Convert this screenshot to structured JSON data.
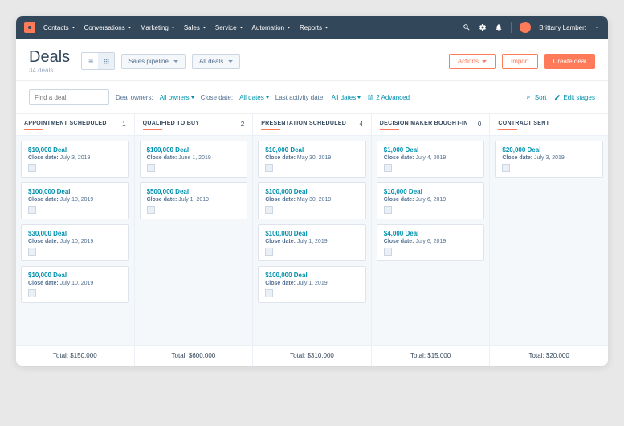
{
  "nav": {
    "items": [
      "Contacts",
      "Conversations",
      "Marketing",
      "Sales",
      "Service",
      "Automation",
      "Reports"
    ],
    "user": "Brittany Lambert"
  },
  "header": {
    "title": "Deals",
    "subtitle": "34 deals",
    "pipeline": "Sales pipeline",
    "filter": "All deals",
    "actions": "Actions",
    "import": "Import",
    "create": "Create deal"
  },
  "filters": {
    "search_placeholder": "Find a deal",
    "owners_label": "Deal owners:",
    "owners_val": "All owners",
    "close_label": "Close date:",
    "close_val": "All dates",
    "activity_label": "Last activity date:",
    "activity_val": "All dates",
    "advanced": "2 Advanced",
    "sort": "Sort",
    "edit": "Edit stages"
  },
  "columns": [
    {
      "title": "APPOINTMENT SCHEDULED",
      "count": "1",
      "total": "Total: $150,000",
      "cards": [
        {
          "title": "$10,000 Deal",
          "close": "July 3, 2019"
        },
        {
          "title": "$100,000 Deal",
          "close": "July 10, 2019"
        },
        {
          "title": "$30,000 Deal",
          "close": "July 10, 2019"
        },
        {
          "title": "$10,000 Deal",
          "close": "July 10, 2019"
        }
      ]
    },
    {
      "title": "QUALIFIED TO BUY",
      "count": "2",
      "total": "Total: $600,000",
      "cards": [
        {
          "title": "$100,000 Deal",
          "close": "June 1, 2019"
        },
        {
          "title": "$500,000 Deal",
          "close": "July 1, 2019"
        }
      ]
    },
    {
      "title": "PRESENTATION SCHEDULED",
      "count": "4",
      "total": "Total: $310,000",
      "cards": [
        {
          "title": "$10,000 Deal",
          "close": "May 30, 2019"
        },
        {
          "title": "$100,000 Deal",
          "close": "May 30, 2019"
        },
        {
          "title": "$100,000 Deal",
          "close": "July 1, 2019"
        },
        {
          "title": "$100,000 Deal",
          "close": "July 1, 2019"
        }
      ]
    },
    {
      "title": "DECISION MAKER BOUGHT-IN",
      "count": "0",
      "total": "Total: $15,000",
      "cards": [
        {
          "title": "$1,000 Deal",
          "close": "July 4, 2019"
        },
        {
          "title": "$10,000 Deal",
          "close": "July 6, 2019"
        },
        {
          "title": "$4,000 Deal",
          "close": "July 6, 2019"
        }
      ]
    },
    {
      "title": "CONTRACT SENT",
      "count": "",
      "total": "Total: $20,000",
      "cards": [
        {
          "title": "$20,000 Deal",
          "close": "July 3, 2019"
        }
      ]
    }
  ],
  "close_label": "Close date:"
}
